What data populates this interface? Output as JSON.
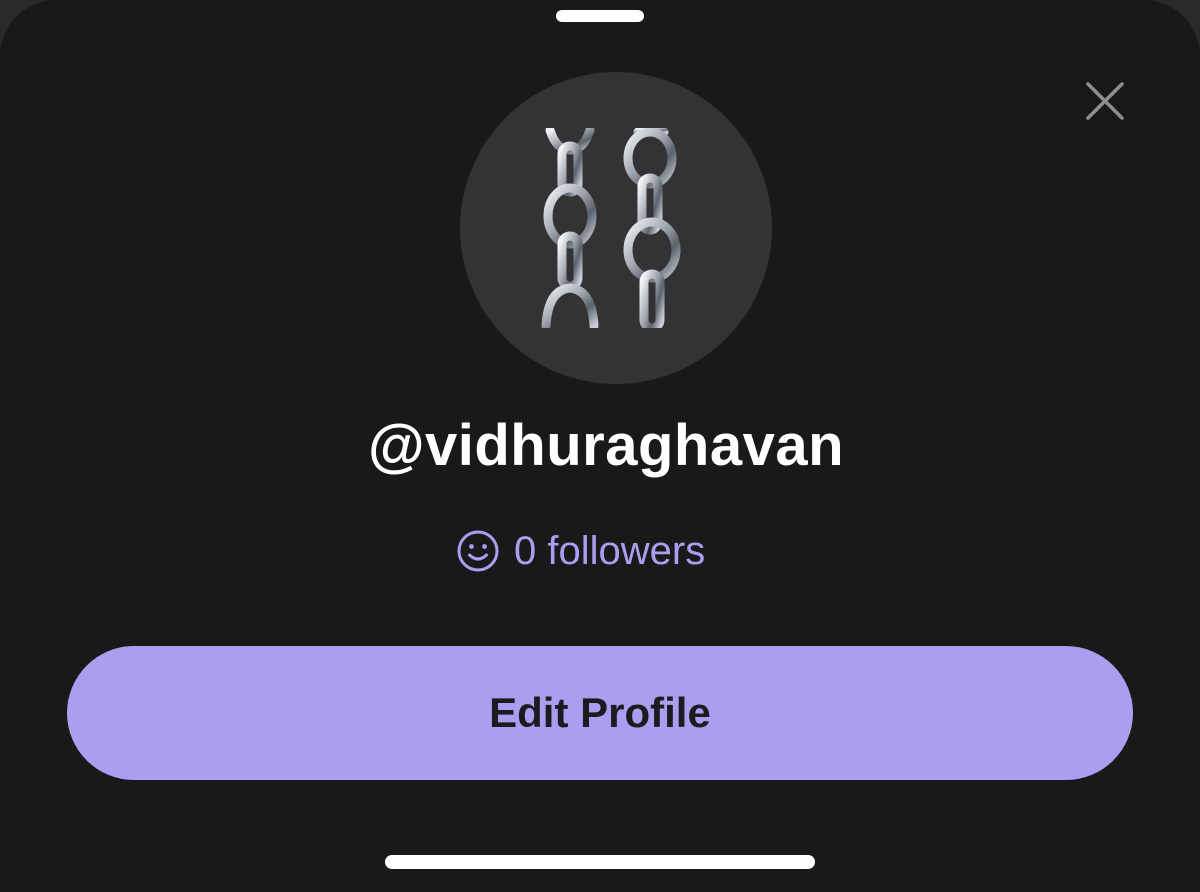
{
  "profile": {
    "username": "@vidhuraghavan",
    "followers_text": "0 followers"
  },
  "actions": {
    "edit_profile_label": "Edit Profile"
  },
  "icons": {
    "close": "close-icon",
    "followers": "smile-icon",
    "avatar": "chains-icon"
  },
  "colors": {
    "background": "#19191a",
    "accent": "#ab9ef0",
    "avatar_bg": "#333335",
    "text": "#ffffff"
  }
}
